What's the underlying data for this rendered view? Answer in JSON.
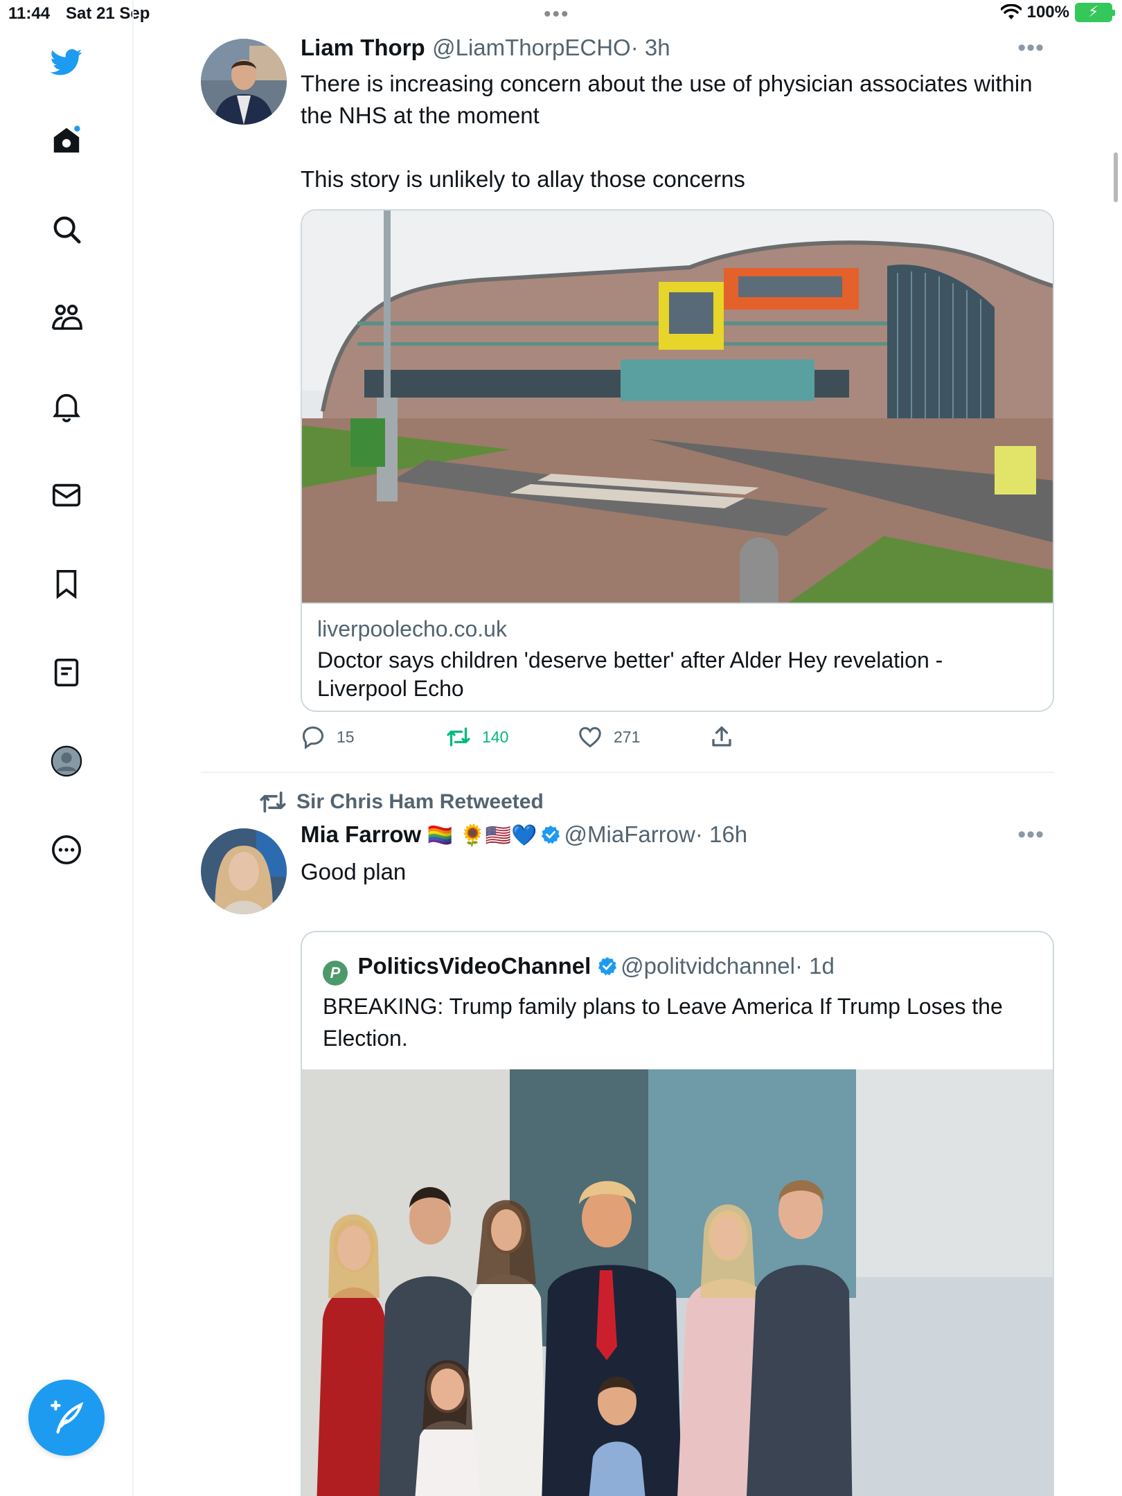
{
  "status_bar": {
    "time": "11:44",
    "date": "Sat 21 Sep",
    "battery": "100%"
  },
  "sidebar": {
    "items": [
      {
        "name": "twitter-logo"
      },
      {
        "name": "home"
      },
      {
        "name": "search"
      },
      {
        "name": "communities"
      },
      {
        "name": "notifications"
      },
      {
        "name": "messages"
      },
      {
        "name": "bookmarks"
      },
      {
        "name": "lists"
      },
      {
        "name": "profile"
      },
      {
        "name": "more"
      }
    ],
    "compose_label": "Compose"
  },
  "tweets": [
    {
      "name": "Liam Thorp",
      "handle": "@LiamThorpECHO",
      "time": "· 3h",
      "text": "There is increasing concern about the use of physician associates within the NHS at the moment\n\nThis story is unlikely to allay those concerns",
      "card": {
        "domain": "liverpoolecho.co.uk",
        "title": "Doctor says children 'deserve better' after Alder Hey revelation - Liverpool Echo"
      },
      "replies": "15",
      "retweets": "140",
      "likes": "271"
    },
    {
      "retweeted_by": "Sir Chris Ham Retweeted",
      "name": "Mia Farrow",
      "emojis": "🏳️‍🌈 🌻🇺🇸💙",
      "handle": "@MiaFarrow",
      "time": "· 16h",
      "text": "Good plan",
      "quote": {
        "logo": "P",
        "name": "PoliticsVideoChannel",
        "handle": "@politvidchannel",
        "time": "· 1d",
        "text": "BREAKING: Trump family plans to Leave America If Trump Loses the Election."
      }
    }
  ],
  "colors": {
    "accent": "#1d9bf0",
    "retweet": "#00ba7c",
    "secondary_text": "#536471"
  }
}
